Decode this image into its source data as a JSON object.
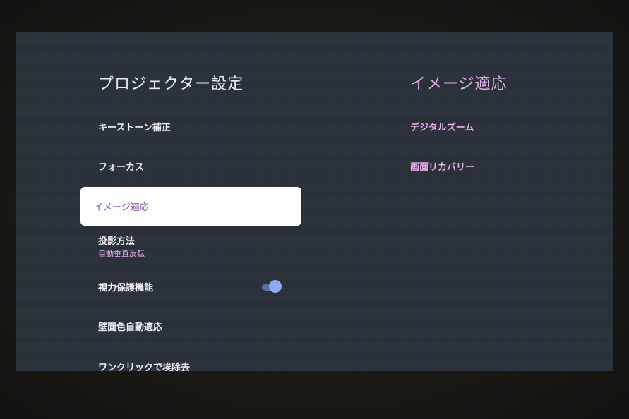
{
  "left_panel": {
    "title": "プロジェクター設定",
    "items": [
      {
        "label": "キーストーン補正"
      },
      {
        "label": "フォーカス"
      },
      {
        "label": "イメージ適応",
        "selected": true
      },
      {
        "label": "投影方法",
        "sub": "自動垂直反転"
      },
      {
        "label": "視力保護機能",
        "toggle": "on"
      },
      {
        "label": "壁面色自動適応"
      },
      {
        "label": "ワンクリックで埃除去"
      }
    ]
  },
  "right_panel": {
    "title": "イメージ適応",
    "items": [
      {
        "label": "デジタルズーム"
      },
      {
        "label": "画面リカバリー"
      }
    ]
  },
  "colors": {
    "accent": "#e6b2ee",
    "toggle_on": "#8eaaf4",
    "screen_bg": "#2b313a"
  }
}
